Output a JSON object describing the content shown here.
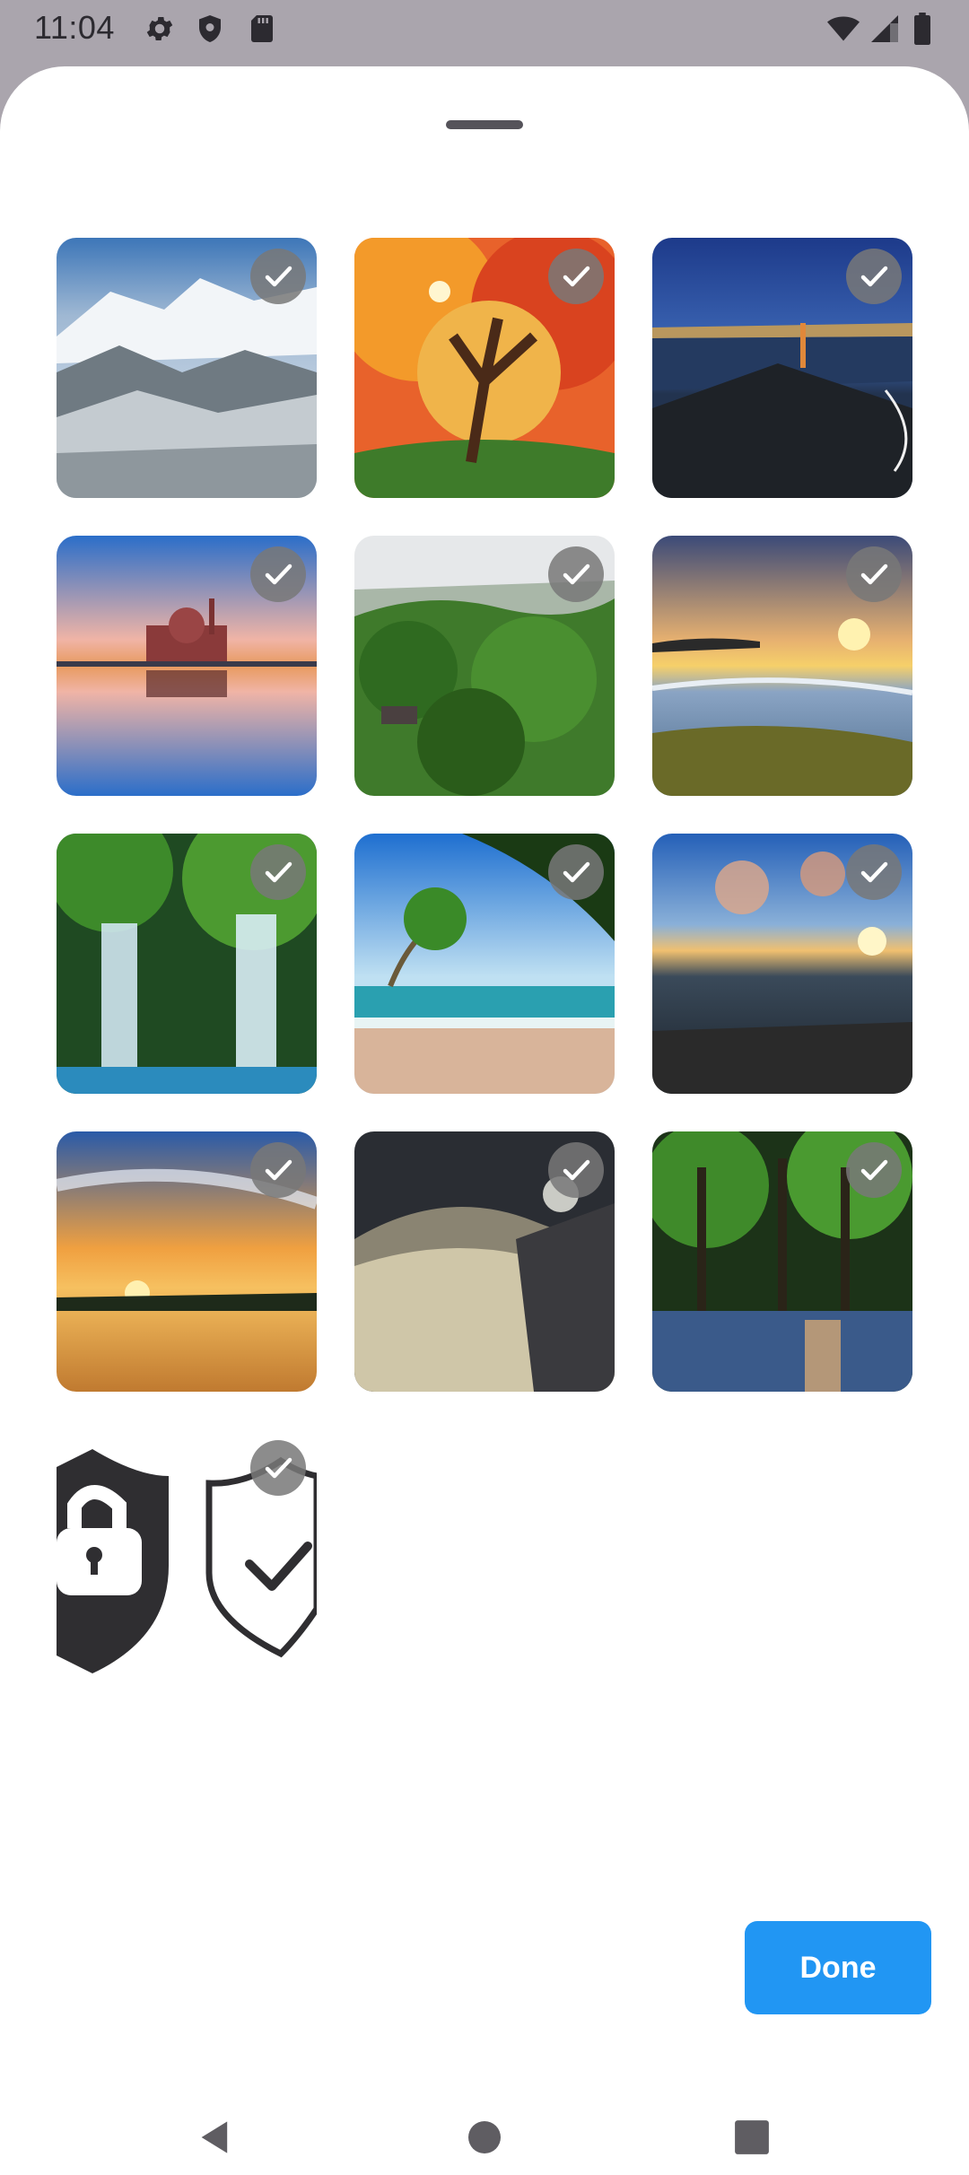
{
  "status_bar": {
    "time": "11:04",
    "left_icons": [
      "settings-icon",
      "shield-icon",
      "sd-card-icon"
    ],
    "right_icons": [
      "wifi-icon",
      "signal-icon",
      "battery-icon"
    ]
  },
  "sheet": {
    "drag_handle": "drag-handle",
    "gallery": {
      "items": [
        {
          "name": "snowy-mountains",
          "selected": true
        },
        {
          "name": "autumn-tree",
          "selected": true
        },
        {
          "name": "golden-gate-night",
          "selected": true
        },
        {
          "name": "mosque-reflection",
          "selected": true
        },
        {
          "name": "green-forest",
          "selected": true
        },
        {
          "name": "sunset-coast",
          "selected": true
        },
        {
          "name": "waterfall",
          "selected": true
        },
        {
          "name": "tropical-beach",
          "selected": true
        },
        {
          "name": "rocky-shore-sunset",
          "selected": true
        },
        {
          "name": "orange-sky-lake",
          "selected": true
        },
        {
          "name": "desert-dunes",
          "selected": true
        },
        {
          "name": "swamp-forest",
          "selected": true
        },
        {
          "name": "security-shields",
          "selected": true
        }
      ]
    },
    "done_button": {
      "label": "Done",
      "color": "#2196f3"
    }
  },
  "nav_bar": {
    "icons": [
      "back-icon",
      "home-icon",
      "recents-icon"
    ]
  },
  "colors": {
    "status_bar_bg": "#aaa5ad",
    "sheet_bg": "#ffffff",
    "check_bg": "#787878"
  }
}
